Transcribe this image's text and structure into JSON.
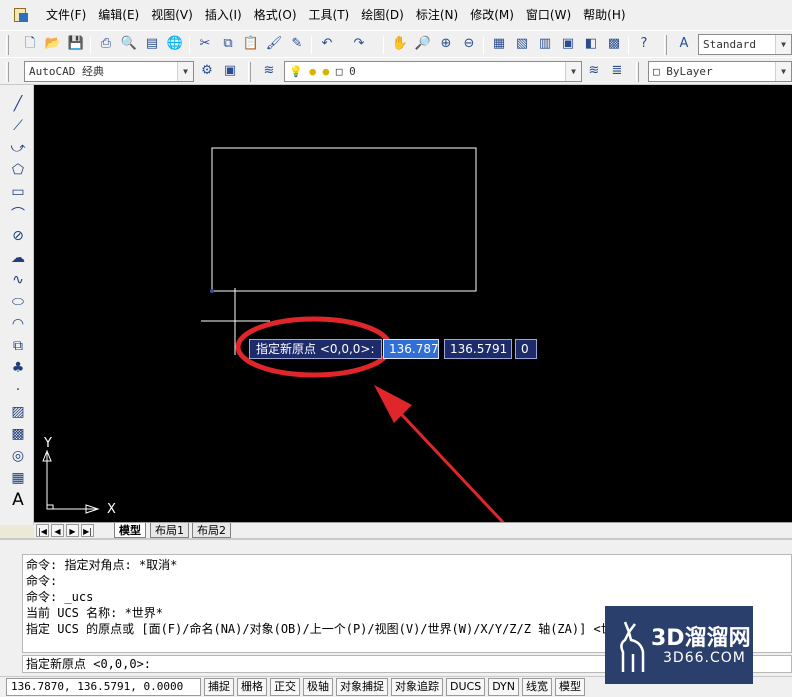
{
  "menu": [
    "文件(F)",
    "编辑(E)",
    "视图(V)",
    "插入(I)",
    "格式(O)",
    "工具(T)",
    "绘图(D)",
    "标注(N)",
    "修改(M)",
    "窗口(W)",
    "帮助(H)"
  ],
  "toolbar": {
    "text_style": "Standard",
    "workspace": "AutoCAD 经典",
    "layer": "0",
    "color": "ByLayer"
  },
  "dynamic_input": {
    "prompt": "指定新原点 <0,0,0>:",
    "x": "136.787",
    "y": "136.5791",
    "z": "0"
  },
  "ucs_icon": {
    "x_label": "X",
    "y_label": "Y"
  },
  "tabs": [
    "模型",
    "布局1",
    "布局2"
  ],
  "command_history": [
    "命令: 指定对角点: *取消*",
    "命令:",
    "命令: _ucs",
    "当前 UCS 名称: *世界*",
    "指定 UCS 的原点或 [面(F)/命名(NA)/对象(OB)/上一个(P)/视图(V)/世界(W)/X/Y/Z/Z 轴(ZA)] <世界>: _o"
  ],
  "command_prompt": "指定新原点 <0,0,0>:",
  "status": {
    "coords": "136.7870, 136.5791, 0.0000",
    "toggles": [
      "捕捉",
      "栅格",
      "正交",
      "极轴",
      "对象捕捉",
      "对象追踪",
      "DUCS",
      "DYN",
      "线宽",
      "模型"
    ]
  },
  "watermark": {
    "brand": "3D溜溜网",
    "url": "3D66.COM"
  },
  "colors": {
    "canvas": "#000000",
    "annotation": "#e0262b",
    "dyn_prompt_bg": "#1e2b6b",
    "dyn_active_bg": "#2f6fd6"
  }
}
